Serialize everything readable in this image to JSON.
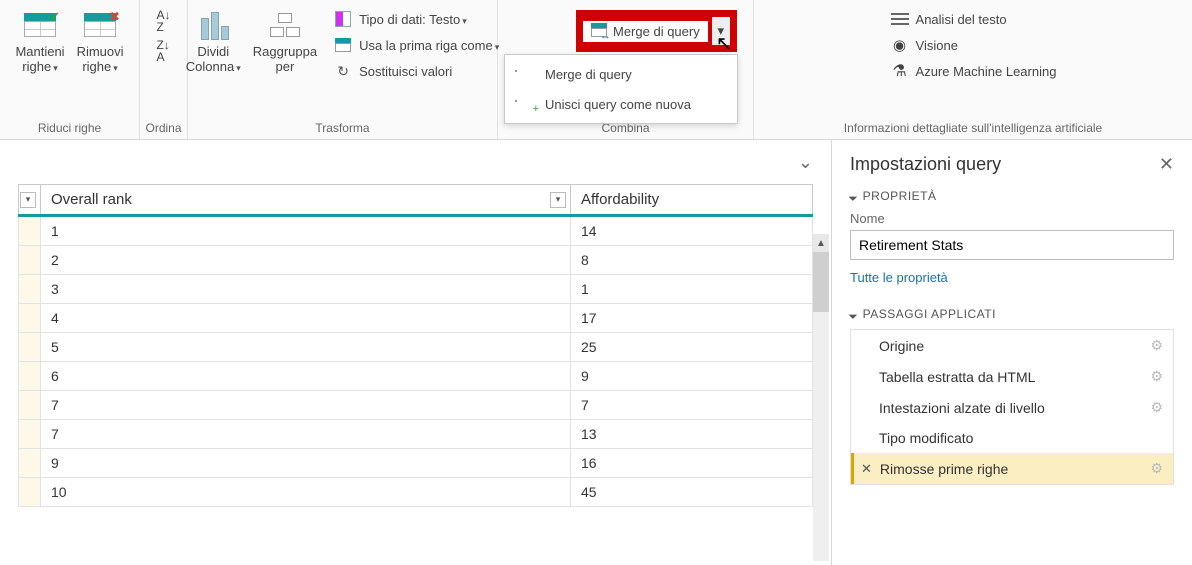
{
  "ribbon": {
    "groups": {
      "reduce": {
        "keep": "Mantieni",
        "remove": "Rimuovi",
        "keep2": "righe",
        "remove2": "righe",
        "label": "Riduci righe"
      },
      "sort": {
        "label": "Ordina"
      },
      "transform": {
        "split": "Dividi",
        "split2": "Colonna",
        "group": "Raggruppa",
        "group2": "per",
        "datatype": "Tipo di dati: Testo",
        "firstrow": "Usa la prima riga come",
        "replace": "Sostituisci valori",
        "label": "Trasforma"
      },
      "combine": {
        "merge": "Merge di query",
        "label": "Combina",
        "dropdown": {
          "merge": "Merge di query",
          "union": "Unisci query come nuova"
        }
      },
      "ai": {
        "text": "Analisi del testo",
        "vision": "Visione",
        "aml": "Azure Machine Learning",
        "label": "Informazioni dettagliate sull'intelligenza artificiale"
      }
    }
  },
  "table": {
    "columns": [
      "Overall rank",
      "Affordability"
    ],
    "rows": [
      {
        "rank": "1",
        "aff": "14"
      },
      {
        "rank": "2",
        "aff": "8"
      },
      {
        "rank": "3",
        "aff": "1"
      },
      {
        "rank": "4",
        "aff": "17"
      },
      {
        "rank": "5",
        "aff": "25"
      },
      {
        "rank": "6",
        "aff": "9"
      },
      {
        "rank": "7",
        "aff": "7"
      },
      {
        "rank": "7",
        "aff": "13"
      },
      {
        "rank": "9",
        "aff": "16"
      },
      {
        "rank": "10",
        "aff": "45"
      }
    ]
  },
  "panel": {
    "title": "Impostazioni query",
    "props_header": "PROPRIETÀ",
    "name_label": "Nome",
    "name_value": "Retirement Stats",
    "all_props": "Tutte le proprietà",
    "steps_header": "PASSAGGI APPLICATI",
    "steps": [
      {
        "label": "Origine",
        "gear": true
      },
      {
        "label": "Tabella estratta da HTML",
        "gear": true
      },
      {
        "label": "Intestazioni alzate di livello",
        "gear": true
      },
      {
        "label": "Tipo modificato",
        "gear": false
      },
      {
        "label": "Rimosse prime righe",
        "gear": true,
        "selected": true
      }
    ]
  }
}
